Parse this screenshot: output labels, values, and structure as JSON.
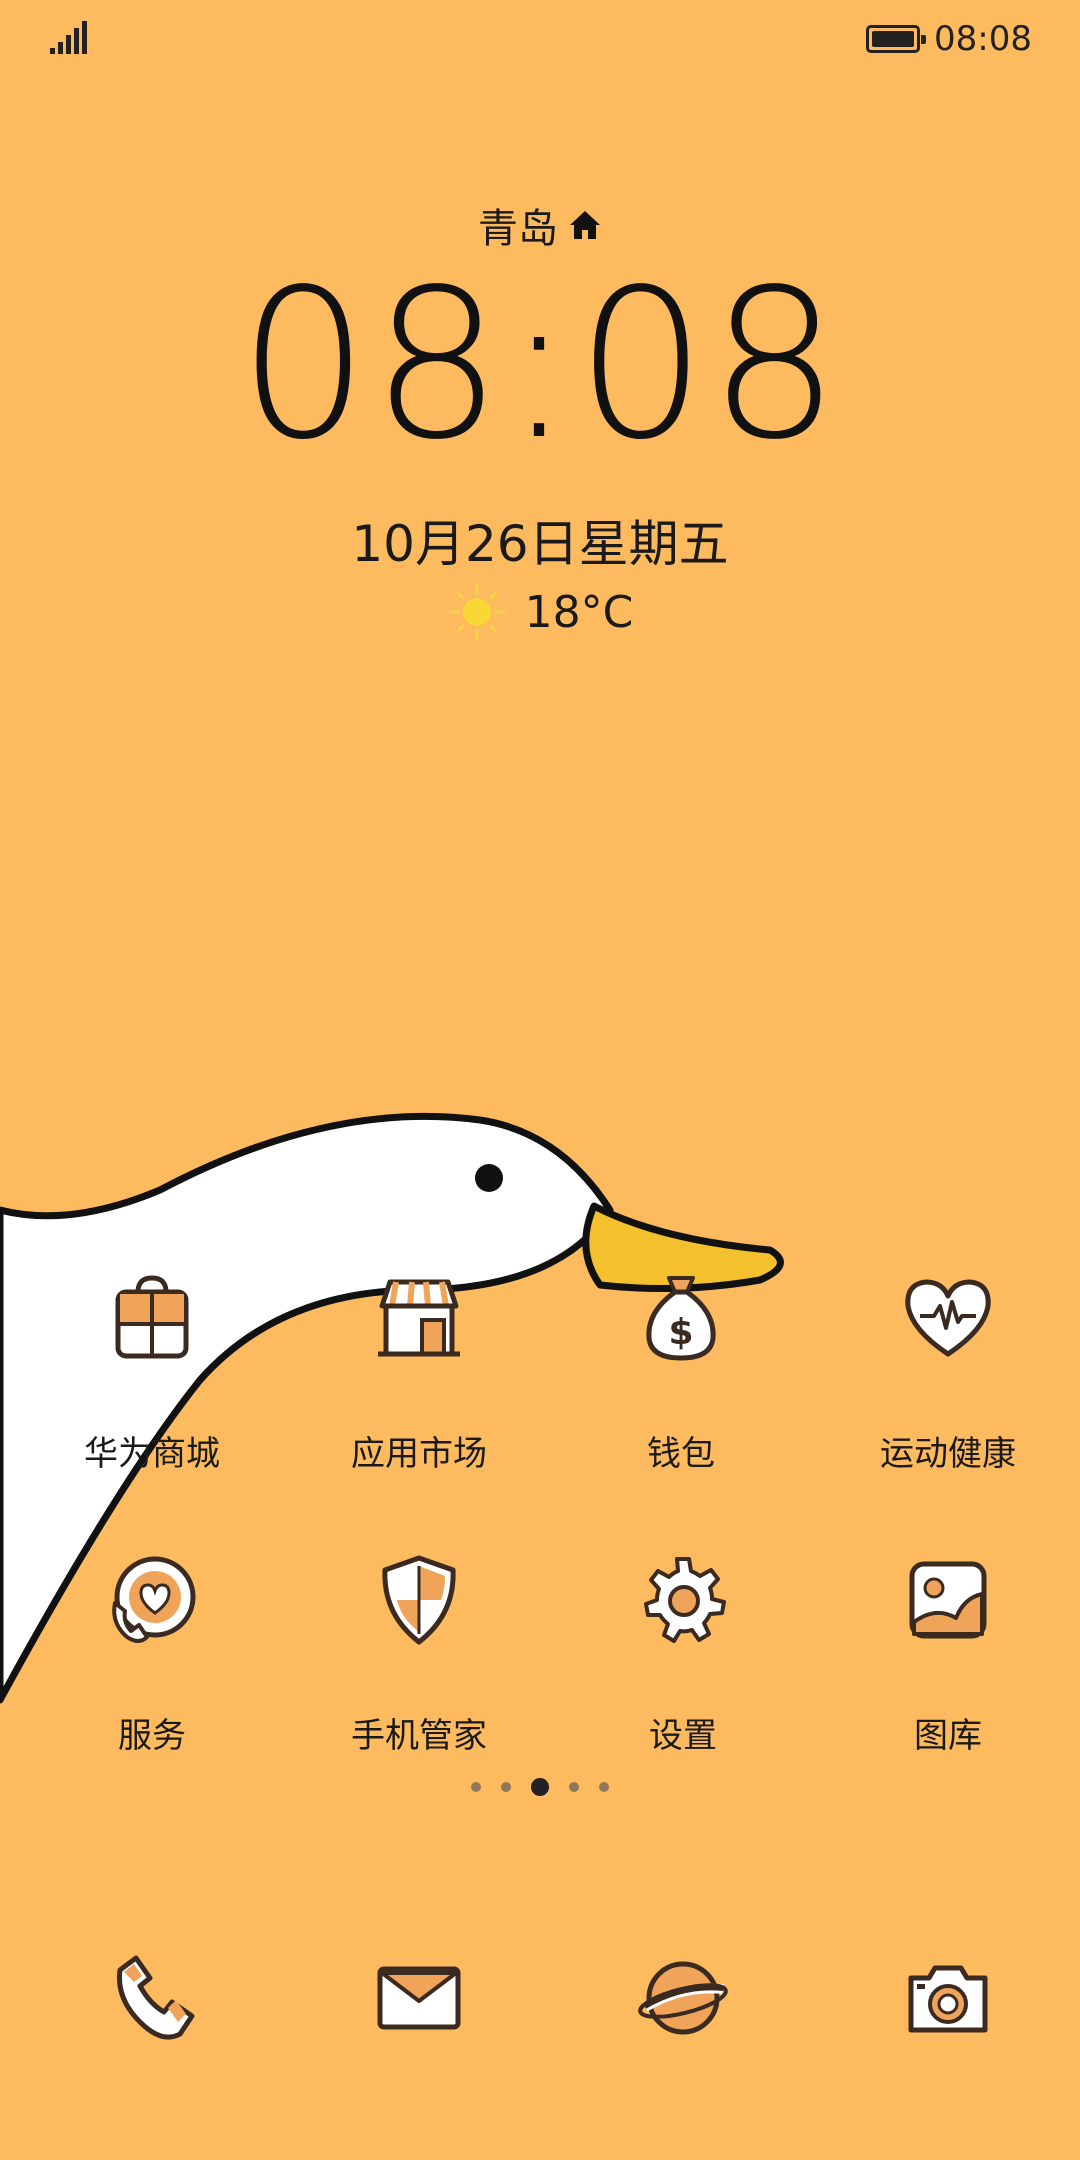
{
  "status_bar": {
    "time": "08:08",
    "battery_level": 1.0,
    "signal_bars": 4
  },
  "clock_widget": {
    "city": "青岛",
    "time": "08:08",
    "date": "10月26日星期五",
    "temperature": "18°C",
    "weather_icon": "sun-icon"
  },
  "apps": [
    {
      "label": "华为商城",
      "icon": "shopping-bag-icon"
    },
    {
      "label": "应用市场",
      "icon": "store-icon"
    },
    {
      "label": "钱包",
      "icon": "money-bag-icon"
    },
    {
      "label": "运动健康",
      "icon": "heart-pulse-icon"
    },
    {
      "label": "服务",
      "icon": "service-phone-icon"
    },
    {
      "label": "手机管家",
      "icon": "shield-icon"
    },
    {
      "label": "设置",
      "icon": "gear-icon"
    },
    {
      "label": "图库",
      "icon": "gallery-icon"
    }
  ],
  "page_indicator": {
    "count": 5,
    "active": 3
  },
  "dock": [
    {
      "icon": "phone-icon"
    },
    {
      "icon": "mail-icon"
    },
    {
      "icon": "browser-planet-icon"
    },
    {
      "icon": "camera-icon"
    }
  ],
  "colors": {
    "background": "#FDBA5E",
    "accent": "#F0A45A",
    "outline": "#3A2A20"
  }
}
